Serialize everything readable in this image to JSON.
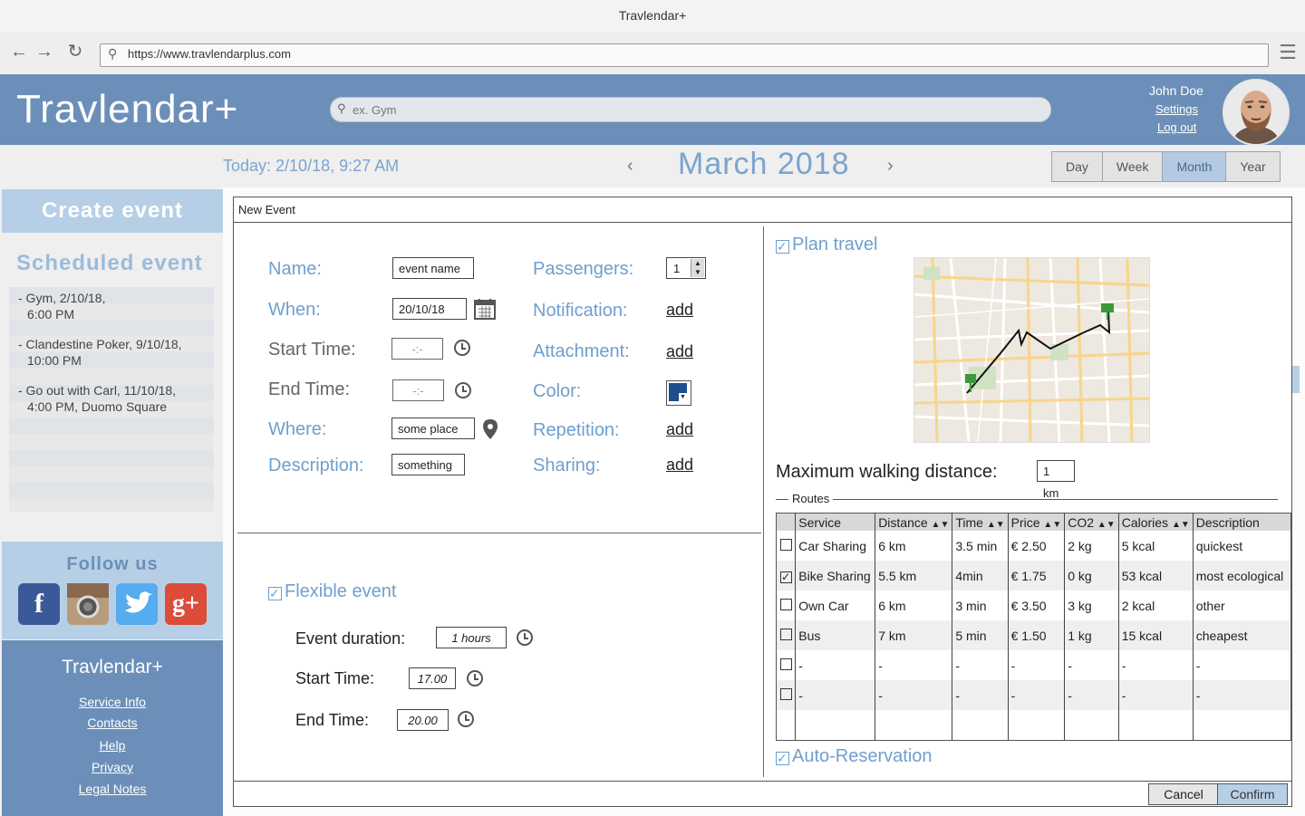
{
  "window": {
    "title": "Travlendar+"
  },
  "browser": {
    "url": "https://www.travlendarplus.com"
  },
  "header": {
    "brand": "Travlendar+",
    "search_placeholder": "ex. Gym",
    "user_name": "John Doe",
    "settings_label": "Settings",
    "logout_label": "Log out"
  },
  "datebar": {
    "today": "Today: 2/10/18, 9:27 AM",
    "prev": "‹",
    "next": "›",
    "month": "March 2018",
    "views": [
      "Day",
      "Week",
      "Month",
      "Year"
    ],
    "active_view": "Month"
  },
  "sidebar": {
    "create_label": "Create event",
    "scheduled_title": "Scheduled event",
    "events": [
      {
        "line1": "- Gym, 2/10/18,",
        "line2": "6:00 PM"
      },
      {
        "line1": "- Clandestine Poker, 9/10/18,",
        "line2": "10:00 PM"
      },
      {
        "line1": "- Go out with Carl, 11/10/18,",
        "line2": "4:00 PM, Duomo Square"
      }
    ],
    "follow_title": "Follow us",
    "socials": [
      "facebook-icon",
      "instagram-icon",
      "twitter-icon",
      "google-plus-icon"
    ],
    "footer_brand": "Travlendar+",
    "footer_links": [
      "Service Info",
      "Contacts",
      "Help",
      "Privacy",
      "Legal Notes"
    ]
  },
  "dialog": {
    "title": "New Event",
    "name_label": "Name:",
    "name_value": "event name",
    "when_label": "When:",
    "when_value": "20/10/18",
    "start_label": "Start Time:",
    "start_value": "-:-",
    "end_label": "End Time:",
    "end_value": "-:-",
    "where_label": "Where:",
    "where_value": "some place",
    "desc_label": "Description:",
    "desc_value": "something",
    "passengers_label": "Passengers:",
    "passengers_value": "1",
    "notification_label": "Notification:",
    "attachment_label": "Attachment:",
    "color_label": "Color:",
    "repetition_label": "Repetition:",
    "sharing_label": "Sharing:",
    "add_label": "add",
    "color_value": "#1f4e8c",
    "flexible_label": "Flexible event",
    "duration_label": "Event duration:",
    "duration_value": "1 hours",
    "flex_start_label": "Start Time:",
    "flex_start_value": "17.00",
    "flex_end_label": "End Time:",
    "flex_end_value": "20.00",
    "plan_travel_label": "Plan travel",
    "max_walk_label": "Maximum walking distance:",
    "max_walk_value": "1 km",
    "routes_legend": "Routes",
    "auto_reservation_label": "Auto-Reservation",
    "cancel_label": "Cancel",
    "confirm_label": "Confirm"
  },
  "routes": {
    "columns": [
      "Service",
      "Distance",
      "Time",
      "Price",
      "CO2",
      "Calories",
      "Description"
    ],
    "rows": [
      {
        "checked": false,
        "cells": [
          "Car Sharing",
          "6 km",
          "3.5 min",
          "€ 2.50",
          "2 kg",
          "5 kcal",
          "quickest"
        ]
      },
      {
        "checked": true,
        "cells": [
          "Bike Sharing",
          "5.5 km",
          "4min",
          "€ 1.75",
          "0 kg",
          "53 kcal",
          "most ecological"
        ]
      },
      {
        "checked": false,
        "cells": [
          "Own Car",
          "6 km",
          "3 min",
          "€ 3.50",
          "3 kg",
          "2 kcal",
          "other"
        ]
      },
      {
        "checked": false,
        "cells": [
          "Bus",
          "7 km",
          "5 min",
          "€ 1.50",
          "1 kg",
          "15 kcal",
          "cheapest"
        ]
      },
      {
        "checked": false,
        "cells": [
          "-",
          "-",
          "-",
          "-",
          "-",
          "-",
          "-"
        ]
      },
      {
        "checked": false,
        "cells": [
          "-",
          "-",
          "-",
          "-",
          "-",
          "-",
          "-"
        ]
      }
    ]
  },
  "colors": {
    "brand": "#6b8fb8",
    "accent_text": "#6f9fce",
    "light_panel": "#b7cfe6"
  }
}
